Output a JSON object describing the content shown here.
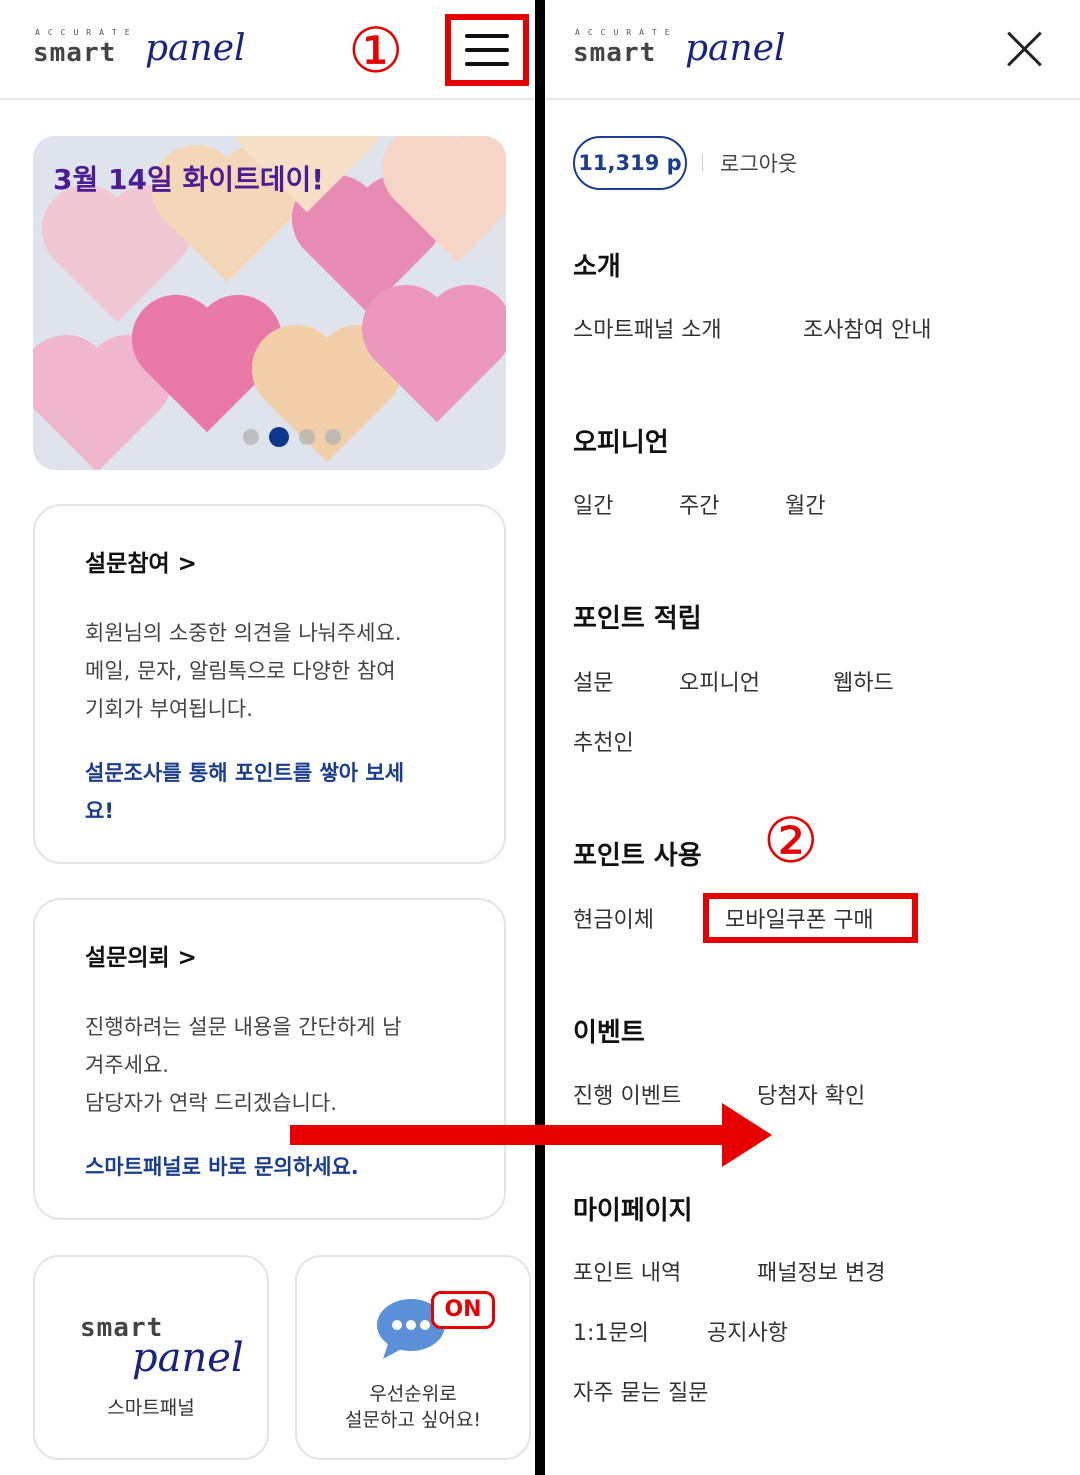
{
  "colors": {
    "accent": "#1a3d8f",
    "annotation": "#e60000",
    "brand_panel": "#1a237e"
  },
  "brand": {
    "tagline": "ACCURATE",
    "word1": "smart",
    "word2": "panel"
  },
  "annotations": {
    "step1": "①",
    "step2": "②"
  },
  "left": {
    "menu_icon": "hamburger-menu-icon",
    "banner": {
      "title": "3월 14일 화이트데이!",
      "slides": 4,
      "active_slide": 2
    },
    "card1": {
      "title": "설문참여 >",
      "body": "회원님의 소중한 의견을 나눠주세요.\n메일, 문자, 알림톡으로 다양한 참여\n기회가 부여됩니다.",
      "link": "설문조사를 통해 포인트를 쌓아 보세\n요!"
    },
    "card2": {
      "title": "설문의뢰 >",
      "body": "진행하려는 설문 내용을 간단하게 남\n겨주세요.\n담당자가 연락 드리겠습니다.",
      "link": "스마트패널로 바로 문의하세요."
    },
    "tile1": {
      "label": "스마트패널"
    },
    "tile2": {
      "badge": "ON",
      "label": "우선순위로\n설문하고 싶어요!"
    }
  },
  "right": {
    "points": "11,319 p",
    "logout": "로그아웃",
    "sections": {
      "intro": {
        "title": "소개",
        "items": [
          "스마트패널 소개",
          "조사참여 안내"
        ]
      },
      "opinion": {
        "title": "오피니언",
        "items": [
          "일간",
          "주간",
          "월간"
        ]
      },
      "earn": {
        "title": "포인트 적립",
        "items": [
          "설문",
          "오피니언",
          "웹하드",
          "추천인"
        ]
      },
      "use": {
        "title": "포인트 사용",
        "items": [
          "현금이체",
          "모바일쿠폰 구매"
        ]
      },
      "event": {
        "title": "이벤트",
        "items": [
          "진행 이벤트",
          "당첨자 확인"
        ]
      },
      "mypage": {
        "title": "마이페이지",
        "items": [
          "포인트 내역",
          "패널정보 변경",
          "1:1문의",
          "공지사항",
          "자주 묻는 질문"
        ]
      }
    }
  }
}
